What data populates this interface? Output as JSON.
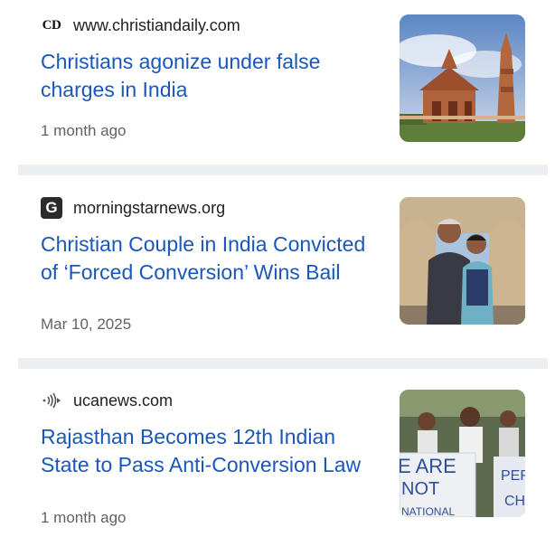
{
  "articles": [
    {
      "source": "www.christiandaily.com",
      "favicon_text": "CD",
      "headline": "Christians agonize under false charges in India",
      "time": "1 month ago",
      "thumbnail_icon": "temple-photo"
    },
    {
      "source": "morningstarnews.org",
      "favicon_text": "G",
      "headline": "Christian Couple in India Convicted of ‘Forced Conversion’ Wins Bail",
      "time": "Mar 10, 2025",
      "thumbnail_icon": "couple-photo"
    },
    {
      "source": "ucanews.com",
      "favicon_icon": "signal-waves-icon",
      "headline": "Rajasthan Becomes 12th Indian State to Pass Anti-Conversion Law",
      "time": "1 month ago",
      "thumbnail_icon": "protest-photo",
      "thumbnail_sign_text": [
        "E ARE",
        "NOT",
        "NATIONAL",
        "PER",
        "CH"
      ]
    }
  ],
  "colors": {
    "headline": "#1a57b8",
    "meta": "#5f6368",
    "divider": "#eceff1"
  }
}
